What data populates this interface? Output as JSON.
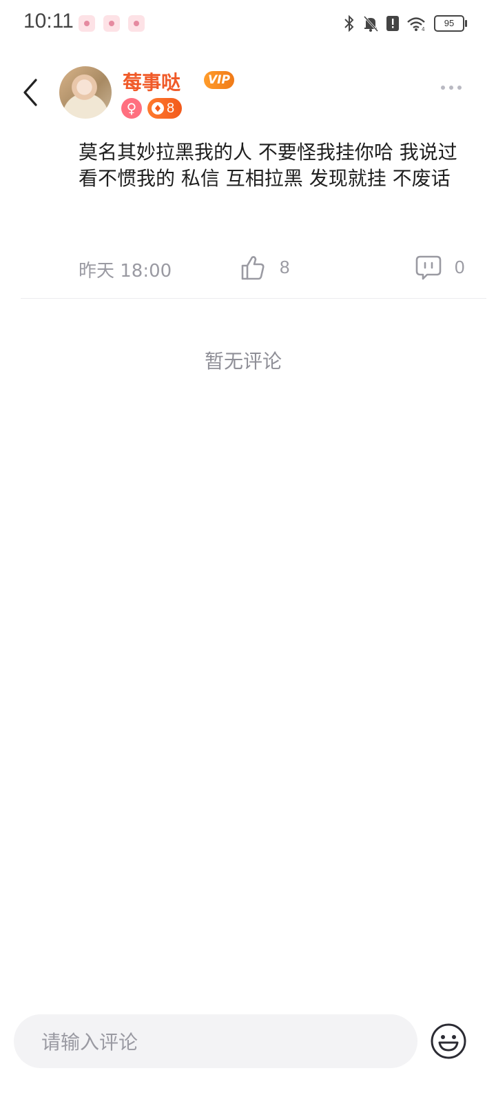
{
  "status_bar": {
    "time": "10:11",
    "battery": "95"
  },
  "user": {
    "name": "莓事哒",
    "vip_label": "VIP",
    "gender_symbol": "♀",
    "level": "8"
  },
  "post": {
    "text": "莫名其妙拉黑我的人 不要怪我挂你哈 我说过 看不惯我的 私信 互相拉黑 发现就挂 不废话",
    "time": "昨天 18:00",
    "likes": "8",
    "comments": "0"
  },
  "comments_section": {
    "empty_text": "暂无评论"
  },
  "input": {
    "placeholder": "请输入评论"
  },
  "colors": {
    "accent": "#f05a28",
    "vip": "#f58a20",
    "gender": "#ff6f7f",
    "muted": "#9a9aa2"
  }
}
